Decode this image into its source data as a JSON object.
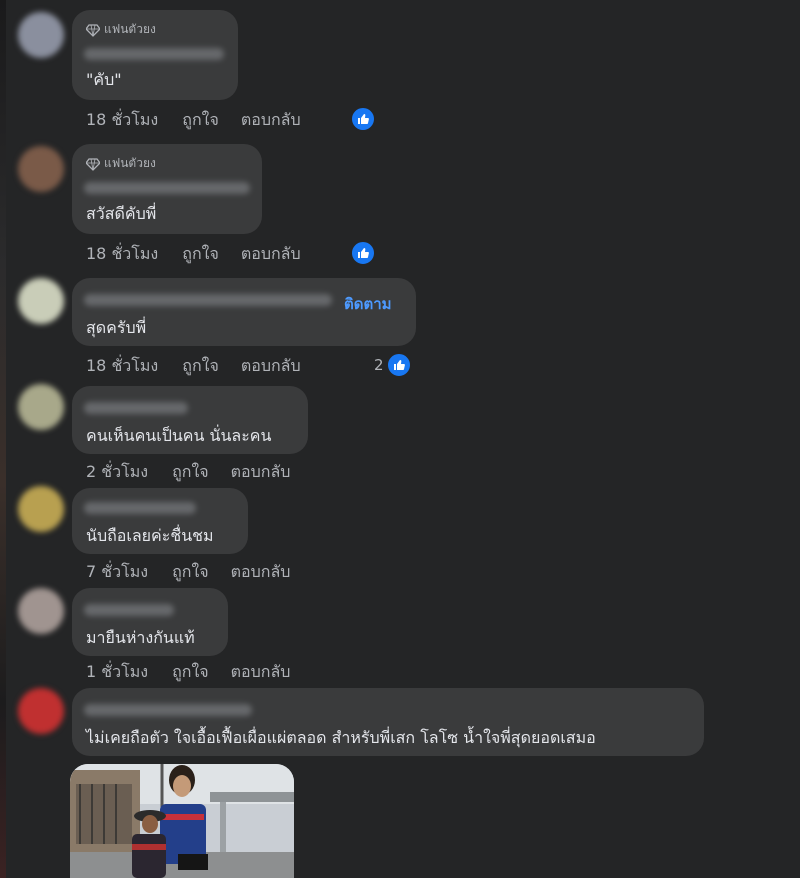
{
  "comments": [
    {
      "badge": "แฟนตัวยง",
      "text": "\"คับ\"",
      "time": "18 ชั่วโมง",
      "like": "ถูกใจ",
      "reply": "ตอบกลับ",
      "reaction_count": "",
      "avatar_color": "#8a8f9e"
    },
    {
      "badge": "แฟนตัวยง",
      "text": "สวัสดีคับพี่",
      "time": "18 ชั่วโมง",
      "like": "ถูกใจ",
      "reply": "ตอบกลับ",
      "reaction_count": "",
      "avatar_color": "#7a5a48"
    },
    {
      "follow": "ติดตาม",
      "text": "สุดครับพี่",
      "time": "18 ชั่วโมง",
      "like": "ถูกใจ",
      "reply": "ตอบกลับ",
      "reaction_count": "2",
      "avatar_color": "#c9cdb8"
    },
    {
      "text": "คนเห็นคนเป็นคน นั่นละคน",
      "time": "2 ชั่วโมง",
      "like": "ถูกใจ",
      "reply": "ตอบกลับ",
      "avatar_color": "#a8a88a"
    },
    {
      "text": "นับถือเลยค่ะชื่นชม",
      "time": "7 ชั่วโมง",
      "like": "ถูกใจ",
      "reply": "ตอบกลับ",
      "avatar_color": "#b8a050"
    },
    {
      "text": "มายืนห่างกันแท้",
      "time": "1 ชั่วโมง",
      "like": "ถูกใจ",
      "reply": "ตอบกลับ",
      "avatar_color": "#a09490"
    },
    {
      "text": "ไม่เคยถือตัว ใจเอื้อเฟื้อเผื่อแผ่ตลอด สำหรับพี่เสก โลโซ น้ำใจพี่สุดยอดเสมอ",
      "avatar_color": "#c03030"
    }
  ],
  "colors": {
    "background": "#242526",
    "bubble": "#3a3b3c",
    "accent": "#1877f2",
    "link": "#4d9aff",
    "meta": "#b0b3b8"
  },
  "icons": {
    "badge": "diamond-icon",
    "reaction": "thumbs-up-icon"
  }
}
